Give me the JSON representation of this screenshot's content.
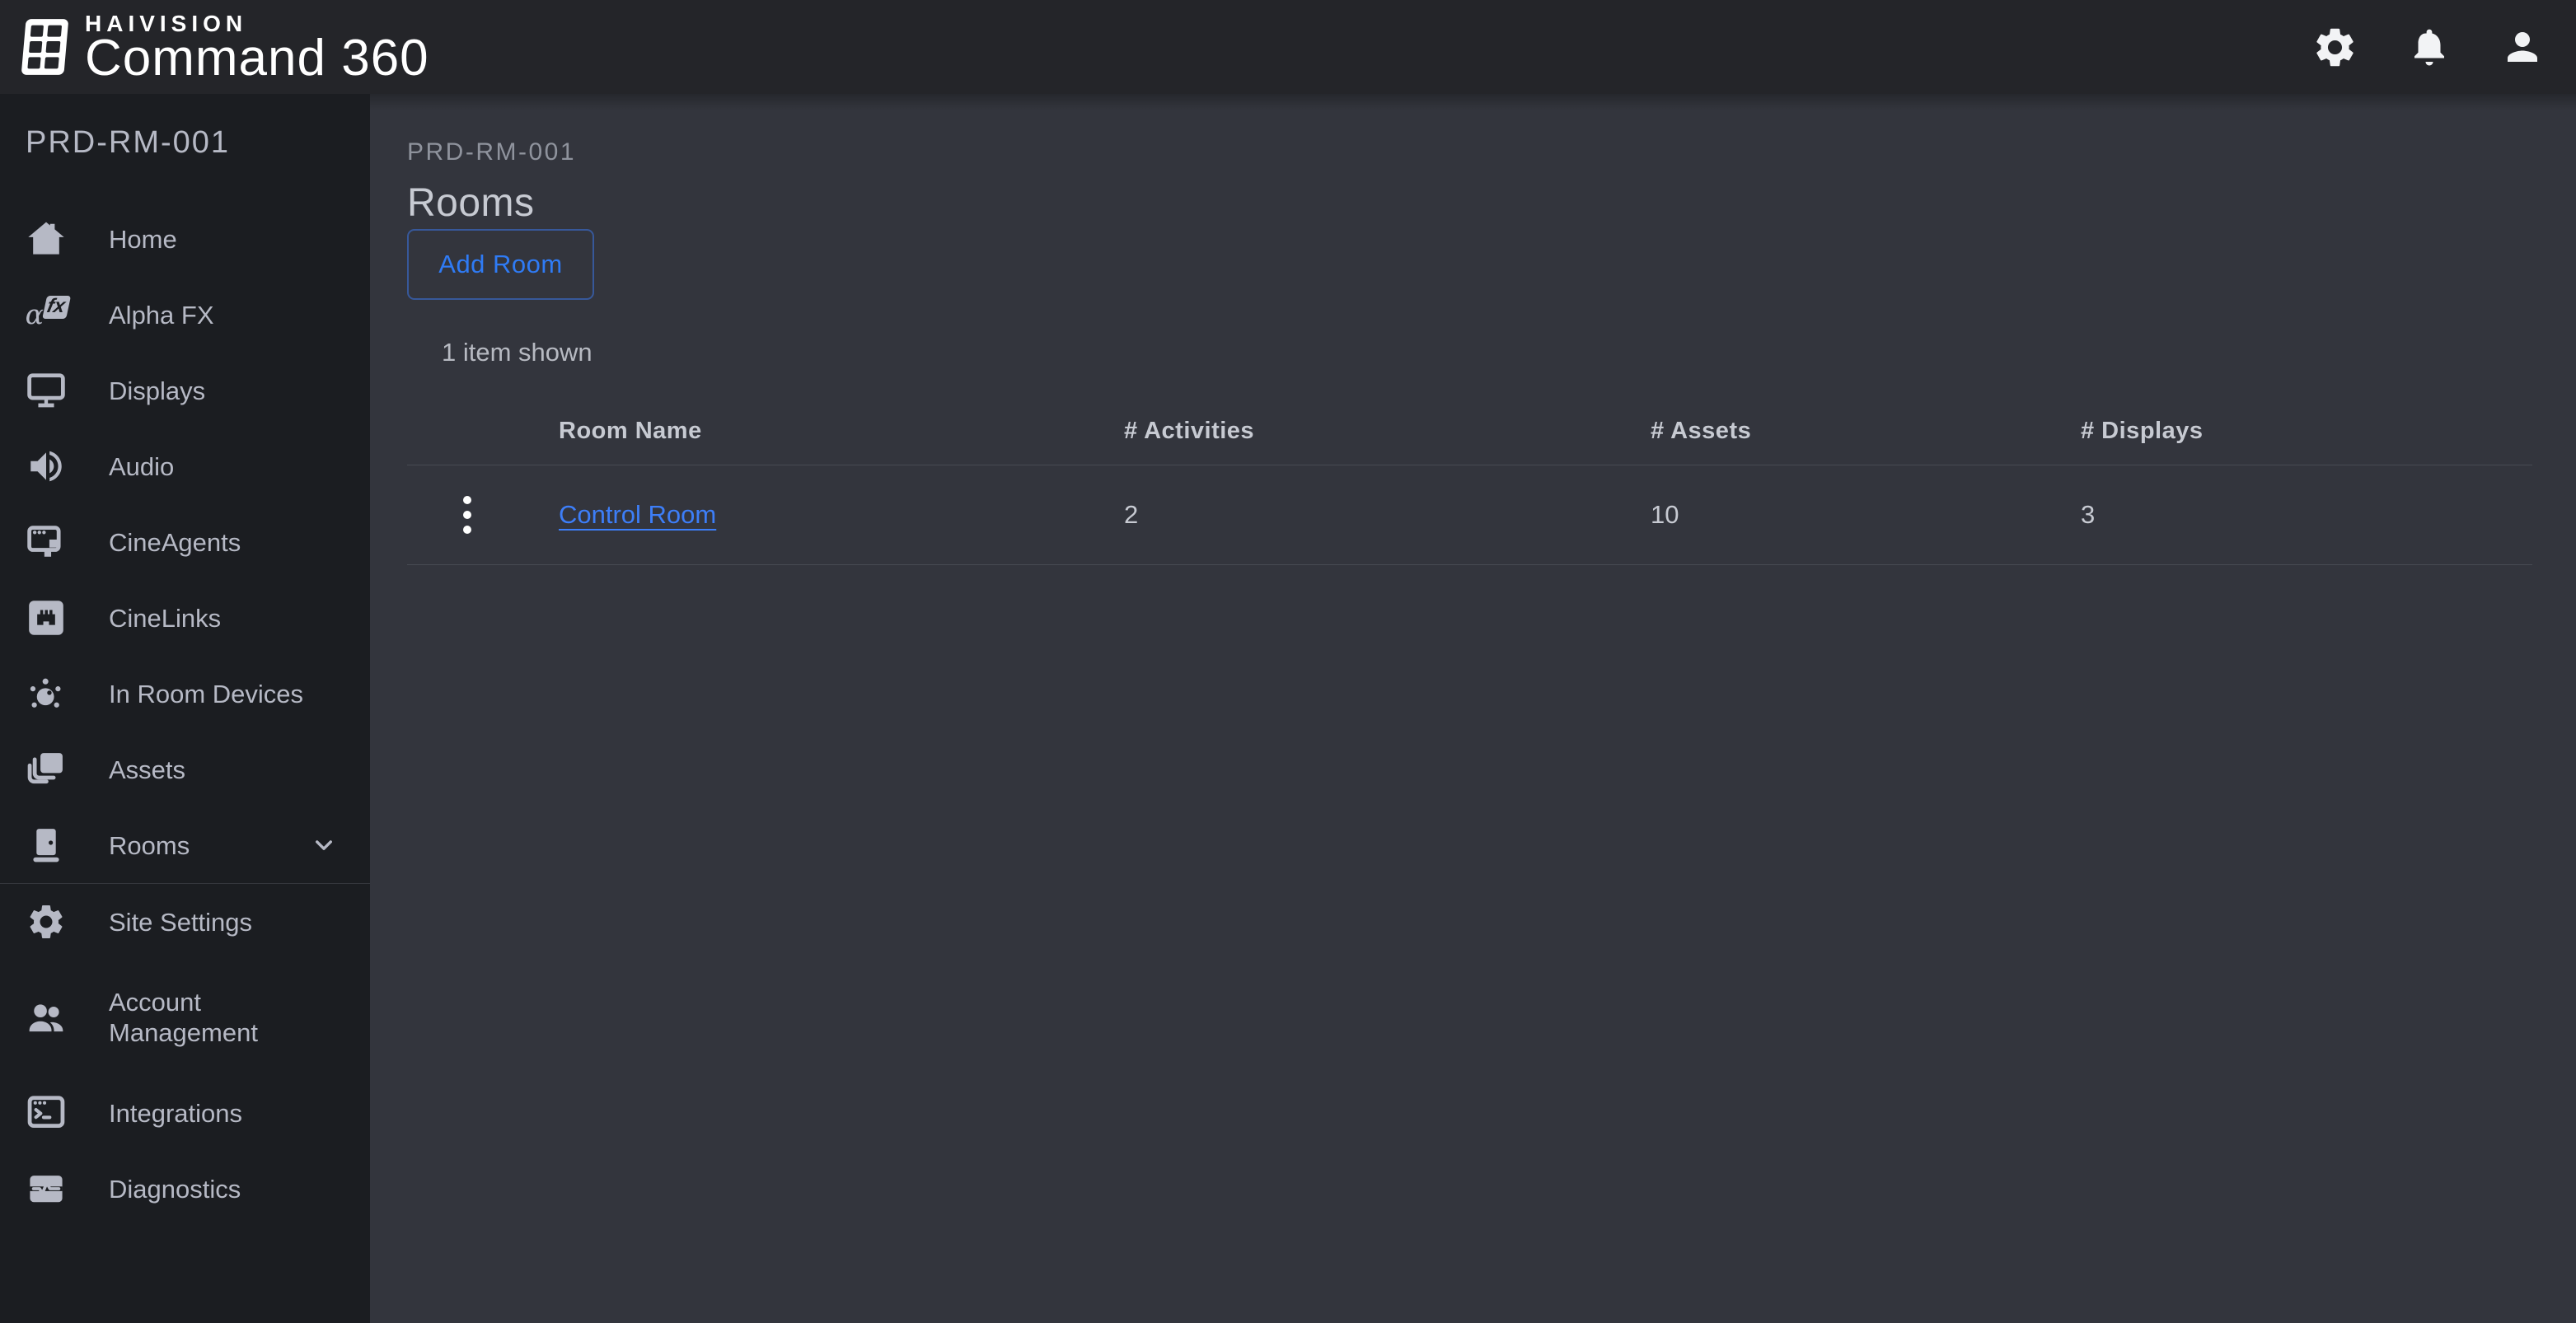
{
  "topbar": {
    "brand": "HAIVISION",
    "product": "Command 360",
    "action_icons": [
      "settings-gear",
      "notifications-bell",
      "user-person"
    ]
  },
  "sidebar": {
    "site_label": "PRD-RM-001",
    "alpha_fx_glyph": {
      "alpha": "α",
      "fx": "fx"
    },
    "items": [
      {
        "label": "Home",
        "icon": "home-icon"
      },
      {
        "label": "Alpha FX",
        "icon": "alpha-fx-icon"
      },
      {
        "label": "Displays",
        "icon": "display-icon"
      },
      {
        "label": "Audio",
        "icon": "audio-speaker-icon"
      },
      {
        "label": "CineAgents",
        "icon": "cineagents-window-icon"
      },
      {
        "label": "CineLinks",
        "icon": "cinelinks-ethernet-icon"
      },
      {
        "label": "In Room Devices",
        "icon": "in-room-devices-icon"
      },
      {
        "label": "Assets",
        "icon": "assets-layers-icon"
      },
      {
        "label": "Rooms",
        "icon": "rooms-door-icon",
        "has_chevron": true
      },
      {
        "label": "Site Settings",
        "icon": "gear-icon"
      },
      {
        "label": "Account Management",
        "icon": "people-icon"
      },
      {
        "label": "Integrations",
        "icon": "terminal-window-icon"
      },
      {
        "label": "Diagnostics",
        "icon": "diagnostics-pulse-icon"
      }
    ]
  },
  "main": {
    "breadcrumb": "PRD-RM-001",
    "title": "Rooms",
    "add_room_label": "Add Room",
    "items_shown": "1 item shown",
    "table": {
      "columns": [
        "Room Name",
        "# Activities",
        "# Assets",
        "# Displays"
      ],
      "rows": [
        {
          "name": "Control Room",
          "activities": "2",
          "assets": "10",
          "displays": "3"
        }
      ]
    }
  },
  "colors": {
    "accent_blue": "#2f7bf5",
    "link_blue": "#3d7ef8",
    "topbar_bg": "#242529",
    "sidebar_bg": "#1b1d21",
    "main_bg": "#33353d",
    "text_light": "#c7cad2",
    "text_muted": "#8f939d"
  }
}
